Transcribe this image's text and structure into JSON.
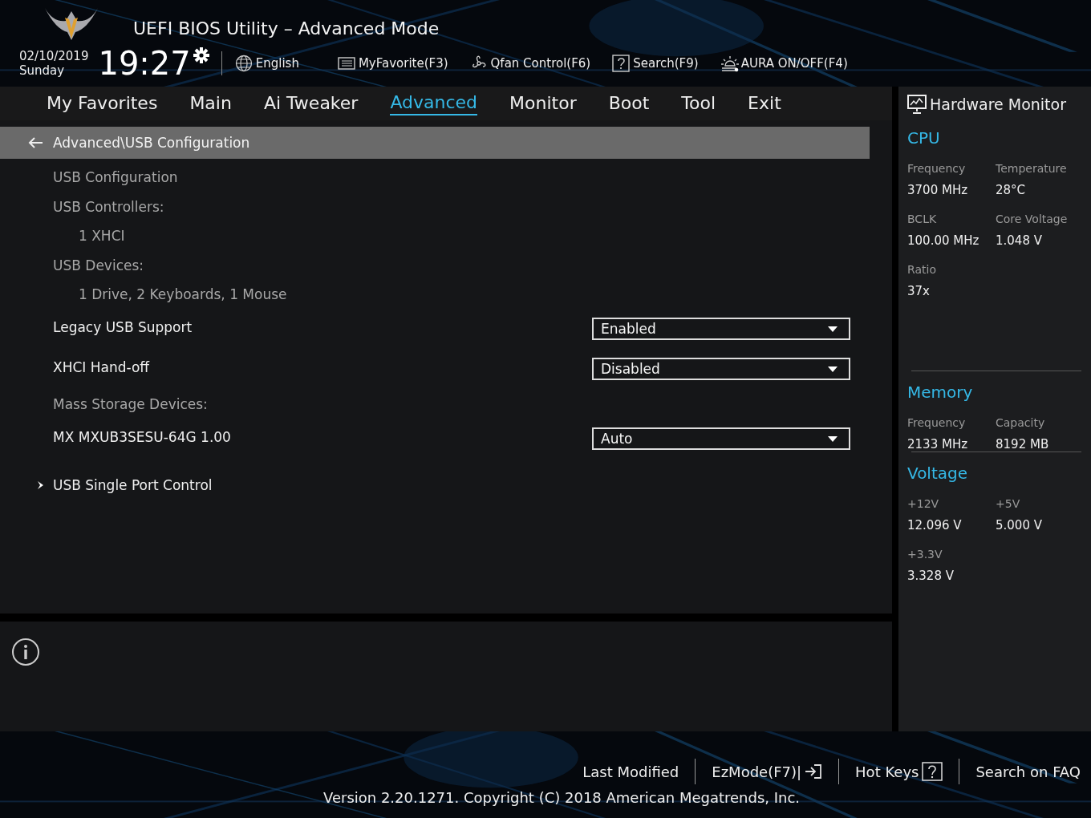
{
  "header": {
    "title": "UEFI BIOS Utility – Advanced Mode",
    "date": "02/10/2019",
    "day": "Sunday",
    "time": "19:27",
    "toolbar": [
      {
        "kind": "language",
        "label": "English"
      },
      {
        "kind": "favorite",
        "label": "MyFavorite(F3)"
      },
      {
        "kind": "fan",
        "label": "Qfan Control(F6)"
      },
      {
        "kind": "search",
        "label": "Search(F9)"
      },
      {
        "kind": "aura",
        "label": "AURA ON/OFF(F4)"
      }
    ]
  },
  "tabs": [
    {
      "label": "My Favorites",
      "selected": false
    },
    {
      "label": "Main",
      "selected": false
    },
    {
      "label": "Ai Tweaker",
      "selected": false
    },
    {
      "label": "Advanced",
      "selected": true
    },
    {
      "label": "Monitor",
      "selected": false
    },
    {
      "label": "Boot",
      "selected": false
    },
    {
      "label": "Tool",
      "selected": false
    },
    {
      "label": "Exit",
      "selected": false
    }
  ],
  "breadcrumb": "Advanced\\USB Configuration",
  "settings": [
    {
      "kind": "heading",
      "label": "USB Configuration"
    },
    {
      "kind": "heading",
      "label": "USB Controllers:"
    },
    {
      "kind": "info",
      "label": "1 XHCI"
    },
    {
      "kind": "heading",
      "label": "USB Devices:"
    },
    {
      "kind": "info",
      "label": "1 Drive, 2 Keyboards, 1 Mouse"
    },
    {
      "kind": "dropdown",
      "label": "Legacy USB Support",
      "value": "Enabled"
    },
    {
      "kind": "dropdown",
      "label": "XHCI Hand-off",
      "value": "Disabled"
    },
    {
      "kind": "heading",
      "label": "Mass Storage Devices:"
    },
    {
      "kind": "dropdown",
      "label": "MX MXUB3SESU-64G 1.00",
      "value": "Auto"
    },
    {
      "kind": "submenu",
      "label": "USB Single Port Control"
    }
  ],
  "hardware_monitor": {
    "title": "Hardware Monitor",
    "sections": [
      {
        "title": "CPU",
        "readings": [
          {
            "label": "Frequency",
            "value": "3700 MHz"
          },
          {
            "label": "Temperature",
            "value": "28°C"
          },
          {
            "label": "BCLK",
            "value": "100.00 MHz"
          },
          {
            "label": "Core Voltage",
            "value": "1.048 V"
          },
          {
            "label": "Ratio",
            "value": "37x"
          }
        ]
      },
      {
        "title": "Memory",
        "readings": [
          {
            "label": "Frequency",
            "value": "2133 MHz"
          },
          {
            "label": "Capacity",
            "value": "8192 MB"
          }
        ]
      },
      {
        "title": "Voltage",
        "readings": [
          {
            "label": "+12V",
            "value": "12.096 V"
          },
          {
            "label": "+5V",
            "value": "5.000 V"
          },
          {
            "label": "+3.3V",
            "value": "3.328 V"
          }
        ]
      }
    ]
  },
  "footer": {
    "links": [
      {
        "kind": "text",
        "label": "Last Modified"
      },
      {
        "kind": "ezmode",
        "label": "EzMode(F7)|"
      },
      {
        "kind": "hotkeys",
        "label": "Hot Keys"
      },
      {
        "kind": "text",
        "label": "Search on FAQ"
      }
    ],
    "version": "Version 2.20.1271. Copyright (C) 2018 American Megatrends, Inc."
  }
}
